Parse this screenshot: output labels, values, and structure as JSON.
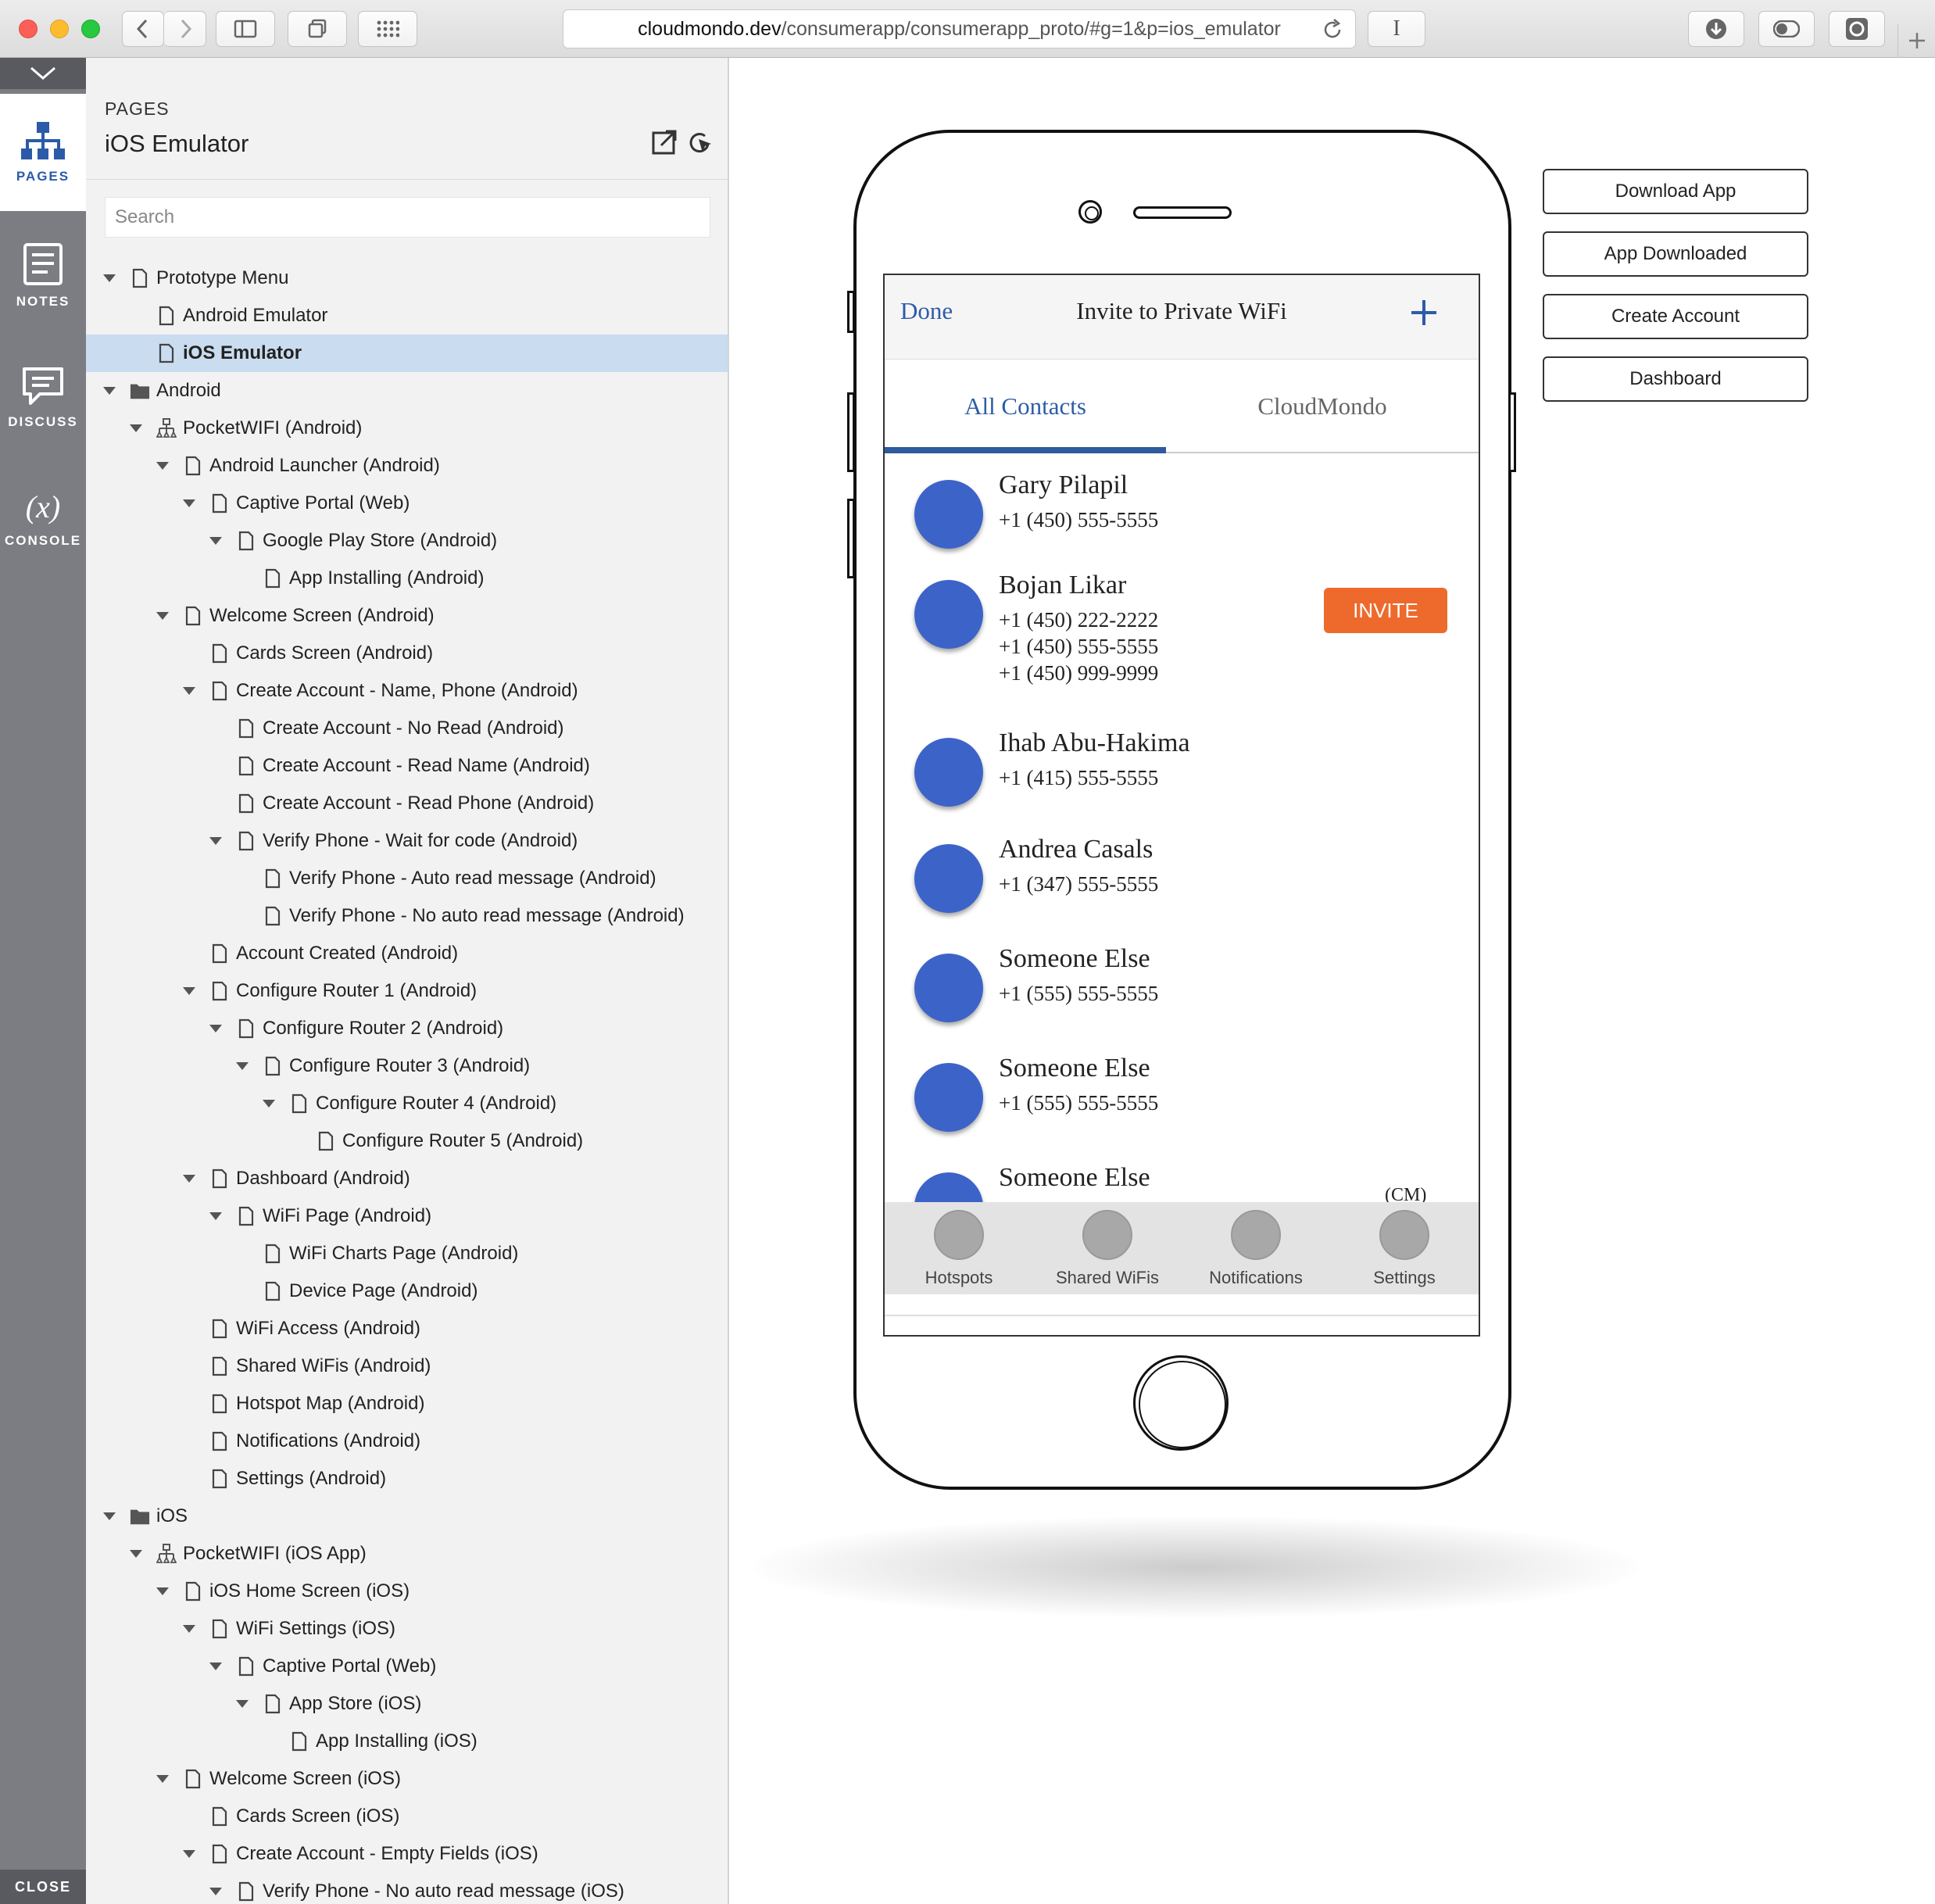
{
  "browser": {
    "url_host": "cloudmondo.dev",
    "url_path": "/consumerapp/consumerapp_proto/#g=1&p=ios_emulator",
    "reader_label": "I"
  },
  "rail": {
    "items": [
      {
        "label": "PAGES"
      },
      {
        "label": "NOTES"
      },
      {
        "label": "DISCUSS"
      },
      {
        "label": "CONSOLE",
        "glyph": "(x)"
      }
    ],
    "close_label": "CLOSE"
  },
  "panel": {
    "heading": "PAGES",
    "title": "iOS Emulator",
    "search_placeholder": "Search",
    "tree": [
      {
        "label": "Prototype Menu",
        "indent": 0,
        "icon": "page",
        "twisty": "open"
      },
      {
        "label": "Android Emulator",
        "indent": 1,
        "icon": "page"
      },
      {
        "label": "iOS Emulator",
        "indent": 1,
        "icon": "page",
        "selected": true
      },
      {
        "label": "Android",
        "indent": 0,
        "icon": "folder",
        "twisty": "open"
      },
      {
        "label": "PocketWIFI (Android)",
        "indent": 1,
        "icon": "flow",
        "twisty": "open"
      },
      {
        "label": "Android Launcher (Android)",
        "indent": 2,
        "icon": "page",
        "twisty": "open"
      },
      {
        "label": "Captive Portal (Web)",
        "indent": 3,
        "icon": "page",
        "twisty": "open"
      },
      {
        "label": "Google Play Store (Android)",
        "indent": 4,
        "icon": "page",
        "twisty": "open"
      },
      {
        "label": "App Installing (Android)",
        "indent": 5,
        "icon": "page"
      },
      {
        "label": "Welcome Screen (Android)",
        "indent": 2,
        "icon": "page",
        "twisty": "open"
      },
      {
        "label": "Cards Screen (Android)",
        "indent": 3,
        "icon": "page"
      },
      {
        "label": "Create Account - Name, Phone (Android)",
        "indent": 3,
        "icon": "page",
        "twisty": "open"
      },
      {
        "label": "Create Account - No Read (Android)",
        "indent": 4,
        "icon": "page"
      },
      {
        "label": "Create Account - Read Name (Android)",
        "indent": 4,
        "icon": "page"
      },
      {
        "label": "Create Account - Read Phone (Android)",
        "indent": 4,
        "icon": "page"
      },
      {
        "label": "Verify Phone - Wait for code (Android)",
        "indent": 4,
        "icon": "page",
        "twisty": "open"
      },
      {
        "label": "Verify Phone - Auto read message (Android)",
        "indent": 5,
        "icon": "page"
      },
      {
        "label": "Verify Phone - No auto read message (Android)",
        "indent": 5,
        "icon": "page"
      },
      {
        "label": "Account Created (Android)",
        "indent": 3,
        "icon": "page"
      },
      {
        "label": "Configure Router 1 (Android)",
        "indent": 3,
        "icon": "page",
        "twisty": "open"
      },
      {
        "label": "Configure Router 2 (Android)",
        "indent": 4,
        "icon": "page",
        "twisty": "open"
      },
      {
        "label": "Configure Router 3 (Android)",
        "indent": 5,
        "icon": "page",
        "twisty": "open"
      },
      {
        "label": "Configure Router 4 (Android)",
        "indent": 6,
        "icon": "page",
        "twisty": "open"
      },
      {
        "label": "Configure Router 5 (Android)",
        "indent": 7,
        "icon": "page"
      },
      {
        "label": "Dashboard (Android)",
        "indent": 3,
        "icon": "page",
        "twisty": "open"
      },
      {
        "label": "WiFi Page (Android)",
        "indent": 4,
        "icon": "page",
        "twisty": "open"
      },
      {
        "label": "WiFi Charts Page (Android)",
        "indent": 5,
        "icon": "page"
      },
      {
        "label": "Device Page (Android)",
        "indent": 5,
        "icon": "page"
      },
      {
        "label": "WiFi Access (Android)",
        "indent": 3,
        "icon": "page"
      },
      {
        "label": "Shared WiFis (Android)",
        "indent": 3,
        "icon": "page"
      },
      {
        "label": "Hotspot Map (Android)",
        "indent": 3,
        "icon": "page"
      },
      {
        "label": "Notifications (Android)",
        "indent": 3,
        "icon": "page"
      },
      {
        "label": "Settings (Android)",
        "indent": 3,
        "icon": "page"
      },
      {
        "label": "iOS",
        "indent": 0,
        "icon": "folder",
        "twisty": "open"
      },
      {
        "label": "PocketWIFI (iOS App)",
        "indent": 1,
        "icon": "flow",
        "twisty": "open"
      },
      {
        "label": "iOS Home Screen (iOS)",
        "indent": 2,
        "icon": "page",
        "twisty": "open"
      },
      {
        "label": "WiFi Settings (iOS)",
        "indent": 3,
        "icon": "page",
        "twisty": "open"
      },
      {
        "label": "Captive Portal (Web)",
        "indent": 4,
        "icon": "page",
        "twisty": "open"
      },
      {
        "label": "App Store (iOS)",
        "indent": 5,
        "icon": "page",
        "twisty": "open"
      },
      {
        "label": "App Installing (iOS)",
        "indent": 6,
        "icon": "page"
      },
      {
        "label": "Welcome Screen (iOS)",
        "indent": 2,
        "icon": "page",
        "twisty": "open"
      },
      {
        "label": "Cards Screen (iOS)",
        "indent": 3,
        "icon": "page"
      },
      {
        "label": "Create Account - Empty Fields (iOS)",
        "indent": 3,
        "icon": "page",
        "twisty": "open"
      },
      {
        "label": "Verify Phone - No auto read message (iOS)",
        "indent": 4,
        "icon": "page",
        "twisty": "open"
      }
    ]
  },
  "phone": {
    "nav": {
      "done": "Done",
      "title": "Invite to Private WiFi",
      "add": "+"
    },
    "tabs": [
      {
        "label": "All Contacts",
        "active": true
      },
      {
        "label": "CloudMondo",
        "active": false
      }
    ],
    "contacts": [
      {
        "name": "Gary Pilapil",
        "phones": [
          "+1 (450) 555-5555"
        ]
      },
      {
        "name": "Bojan Likar",
        "phones": [
          "+1 (450) 222-2222",
          "+1 (450) 555-5555",
          "+1 (450) 999-9999"
        ]
      },
      {
        "name": "Ihab Abu-Hakima",
        "phones": [
          "+1 (415) 555-5555"
        ]
      },
      {
        "name": "Andrea Casals",
        "phones": [
          "+1 (347) 555-5555"
        ]
      },
      {
        "name": "Someone Else",
        "phones": [
          "+1 (555) 555-5555"
        ]
      },
      {
        "name": "Someone Else",
        "phones": [
          "+1 (555) 555-5555"
        ]
      },
      {
        "name": "Someone Else",
        "phones": []
      }
    ],
    "invite_label": "INVITE",
    "cm_fragment": "(CM)",
    "tabbar": [
      "Hotspots",
      "Shared WiFis",
      "Notifications",
      "Settings"
    ]
  },
  "canvas_buttons": [
    "Download App",
    "App Downloaded",
    "Create Account",
    "Dashboard"
  ],
  "colors": {
    "accent": "#2d5ca8",
    "invite": "#ee6a2c",
    "avatar": "#3c63c8",
    "selected_row": "#cadcef",
    "rail": "#7b7d82"
  }
}
